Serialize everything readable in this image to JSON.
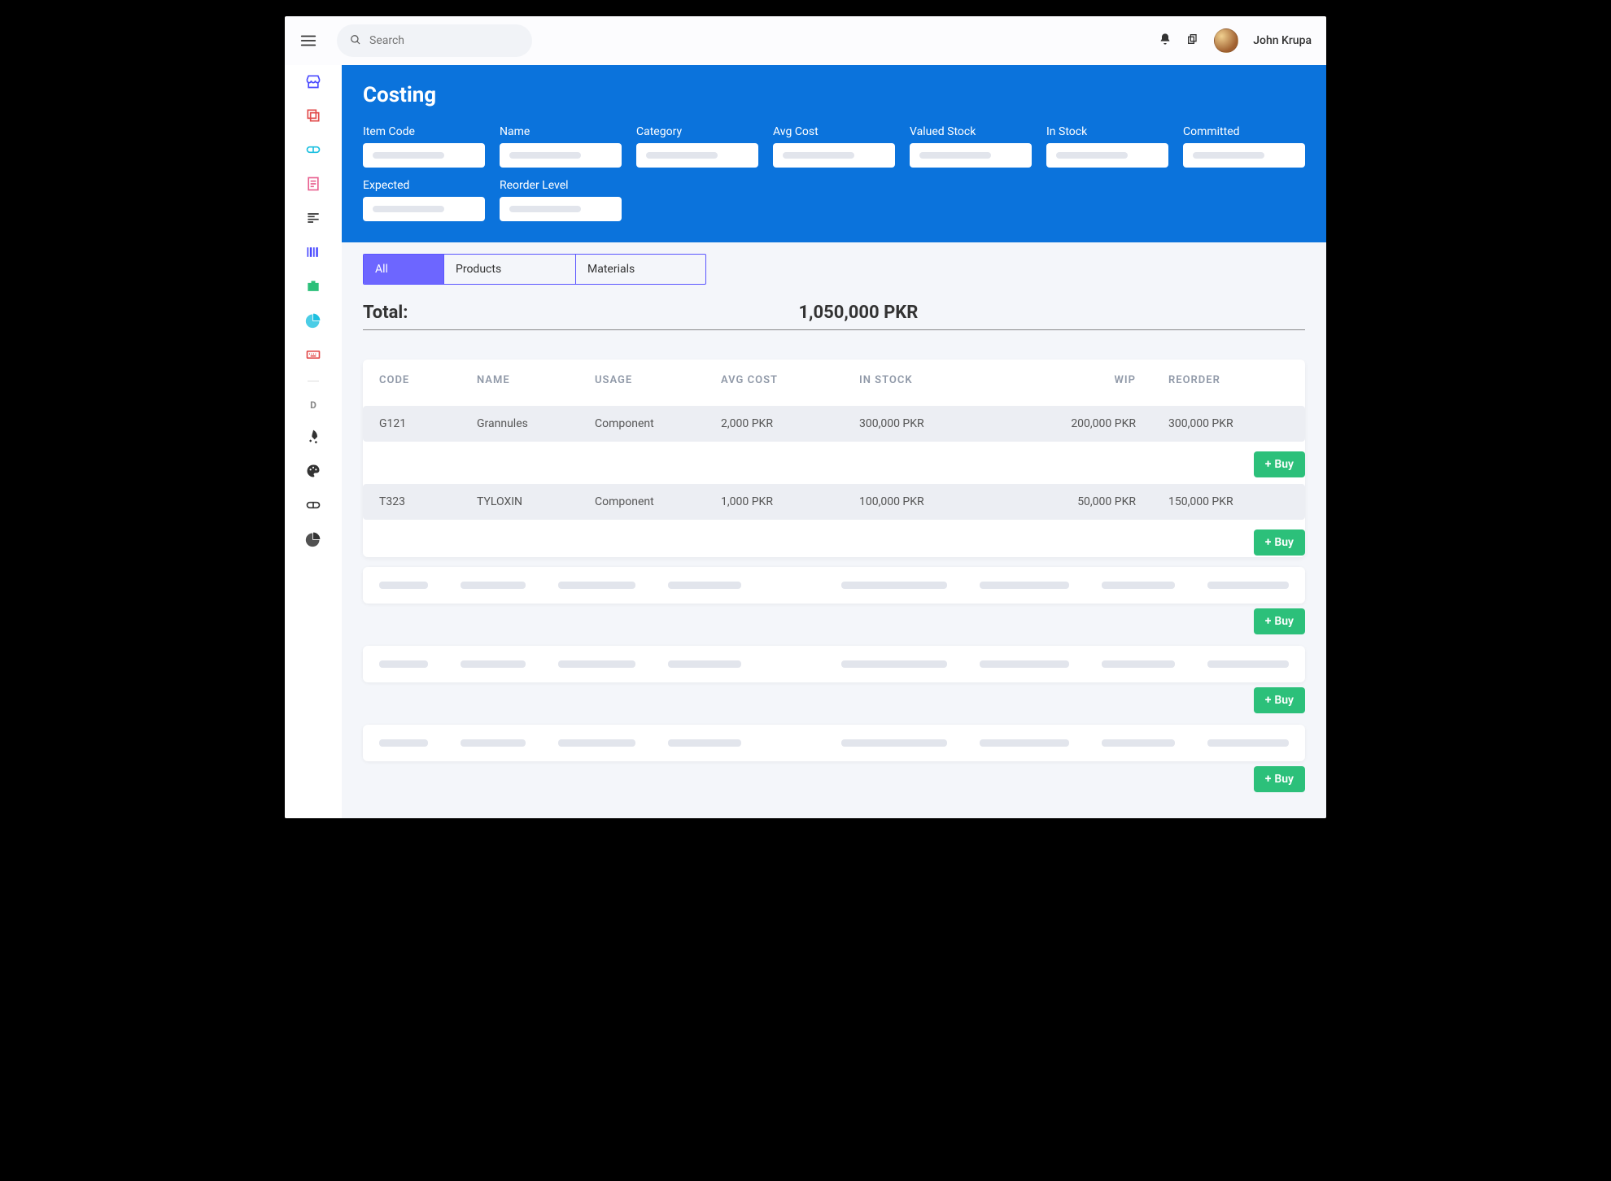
{
  "header": {
    "search_placeholder": "Search",
    "user_name": "John Krupa"
  },
  "page": {
    "title": "Costing",
    "filters": [
      {
        "label": "Item Code"
      },
      {
        "label": "Name"
      },
      {
        "label": "Category"
      },
      {
        "label": "Avg Cost"
      },
      {
        "label": "Valued Stock"
      },
      {
        "label": "In Stock"
      },
      {
        "label": "Committed"
      },
      {
        "label": "Expected"
      },
      {
        "label": "Reorder Level"
      }
    ],
    "tabs": [
      {
        "label": "All",
        "active": true
      },
      {
        "label": "Products",
        "active": false
      },
      {
        "label": "Materials",
        "active": false
      }
    ],
    "total": {
      "label": "Total:",
      "value": "1,050,000 PKR"
    },
    "columns": [
      "CODE",
      "NAME",
      "USAGE",
      "AVG COST",
      "IN STOCK",
      "WIP",
      "REORDER"
    ],
    "rows": [
      {
        "code": "G121",
        "name": "Grannules",
        "usage": "Component",
        "avg": "2,000 PKR",
        "stock": "300,000 PKR",
        "wip": "200,000 PKR",
        "reorder": "300,000 PKR"
      },
      {
        "code": "T323",
        "name": "TYLOXIN",
        "usage": "Component",
        "avg": "1,000 PKR",
        "stock": "100,000 PKR",
        "wip": "50,000 PKR",
        "reorder": "150,000 PKR"
      }
    ],
    "buy_label": "Buy",
    "skeleton_rows": 3,
    "sidebar_d_label": "D"
  }
}
